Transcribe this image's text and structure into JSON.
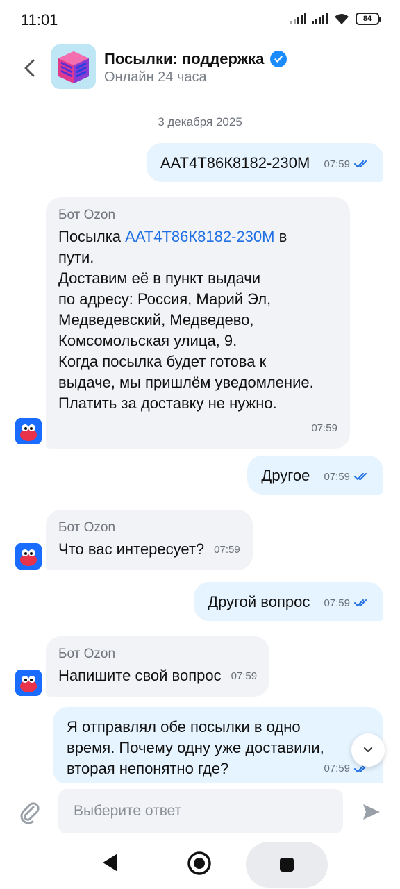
{
  "status": {
    "time": "11:01",
    "battery": "84"
  },
  "header": {
    "title": "Посылки: поддержка",
    "subtitle": "Онлайн 24 часа"
  },
  "chat": {
    "date": "3 декабря 2025",
    "messages": [
      {
        "dir": "out",
        "text": "ААТ4Т86К8182-230М",
        "time": "07:59"
      },
      {
        "dir": "in",
        "sender": "Бот Ozon",
        "pre": "Посылка ",
        "link": "ААТ4Т86К8182-230М",
        "post": " в",
        "lines": [
          "пути.",
          "Доставим её в пункт выдачи",
          "по адресу: Россия, Марий Эл,",
          "Медведевский, Медведево,",
          "Комсомольская улица, 9.",
          "Когда посылка будет готова к",
          "выдаче, мы пришлём уведомление.",
          "Платить за доставку не нужно."
        ],
        "time": "07:59"
      },
      {
        "dir": "out",
        "text": "Другое",
        "time": "07:59"
      },
      {
        "dir": "in",
        "sender": "Бот Ozon",
        "text": "Что вас интересует?",
        "time": "07:59"
      },
      {
        "dir": "out",
        "text": "Другой вопрос",
        "time": "07:59"
      },
      {
        "dir": "in",
        "sender": "Бот Ozon",
        "text": "Напишите свой вопрос",
        "time": "07:59"
      },
      {
        "dir": "out",
        "lines": [
          "Я отправлял обе посылки в одно",
          "время. Почему одну уже доставили,",
          "вторая непонятно где?"
        ],
        "time": "07:59"
      }
    ]
  },
  "input": {
    "placeholder": "Выберите ответ"
  },
  "colors": {
    "accent": "#1a8cff",
    "outgoing_bubble": "#e6f4ff",
    "incoming_bubble": "#f1f3f6",
    "link": "#1f6fe5"
  }
}
